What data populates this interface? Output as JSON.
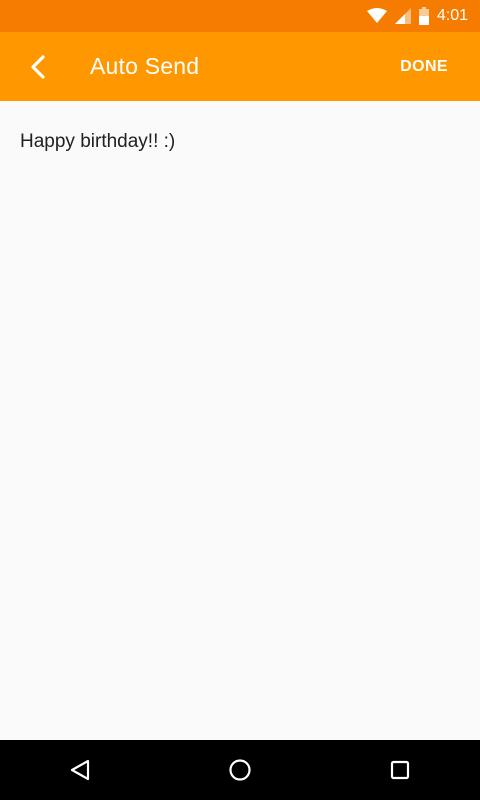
{
  "status_bar": {
    "time": "4:01",
    "icons": [
      "wifi-icon",
      "signal-icon",
      "battery-icon"
    ]
  },
  "app_bar": {
    "back_icon": "chevron-left-icon",
    "title": "Auto Send",
    "done_label": "DONE"
  },
  "content": {
    "message_text": "Happy birthday!! :)"
  },
  "nav_bar": {
    "icons": [
      "back-triangle-icon",
      "home-circle-icon",
      "recents-square-icon"
    ]
  },
  "colors": {
    "status_bar": "#f57c00",
    "app_bar": "#ff9800",
    "background": "#fafafa",
    "nav_bar": "#000000"
  }
}
